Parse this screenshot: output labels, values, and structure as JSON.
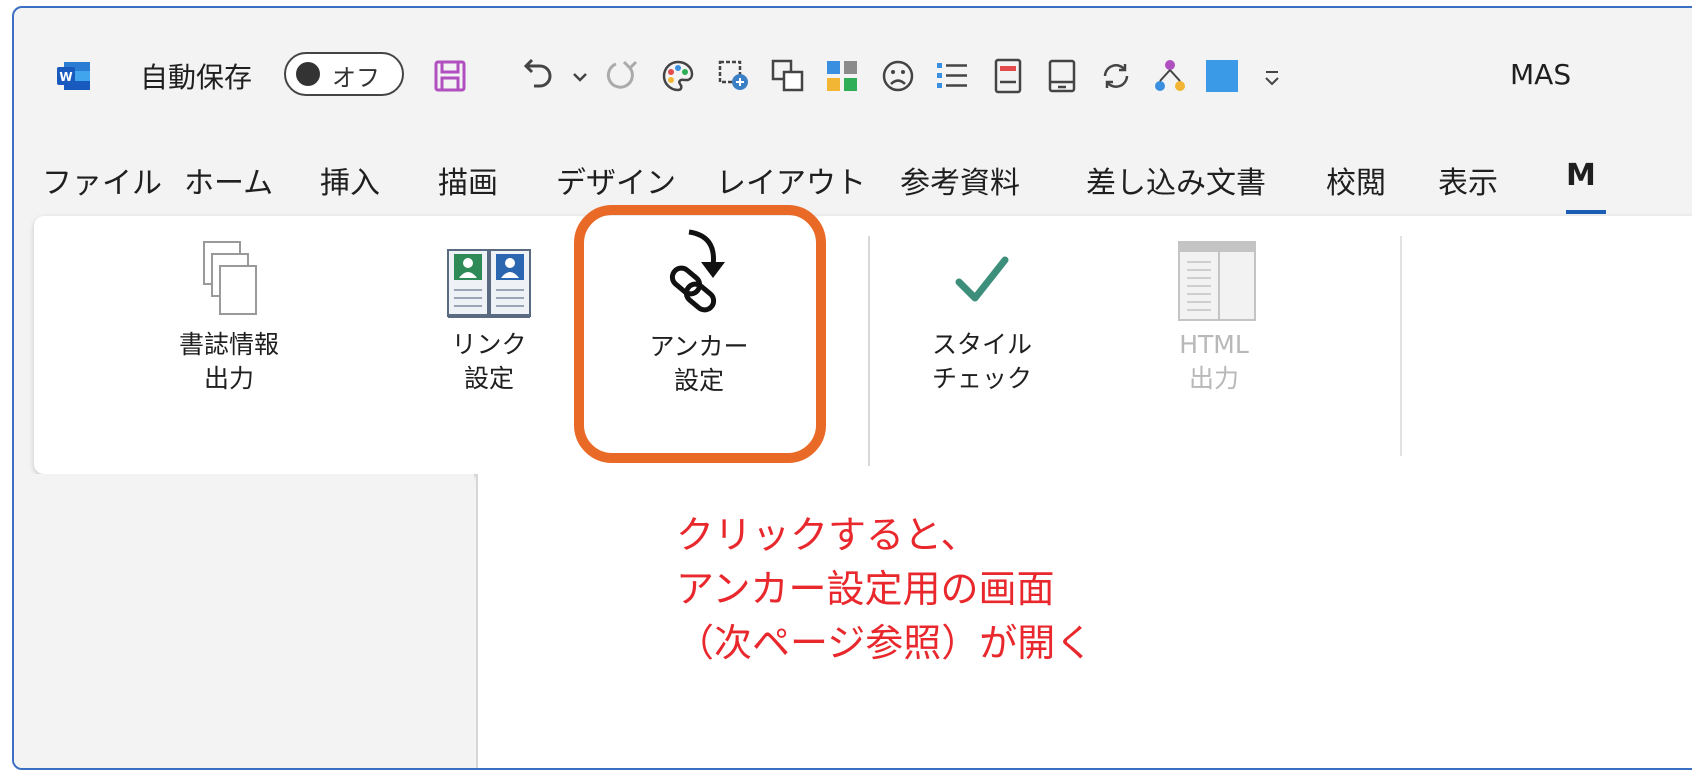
{
  "quick_access": {
    "autosave_label": "自動保存",
    "autosave_state": "オフ",
    "doc_title": "MAS",
    "icons": [
      "word-app-icon",
      "save-icon",
      "undo-icon",
      "undo-dropdown-icon",
      "redo-icon",
      "palette-icon",
      "screen-capture-icon",
      "copy-window-icon",
      "grid-icon",
      "sad-face-icon",
      "bullet-list-icon",
      "form-icon",
      "phone-icon",
      "refresh-icon",
      "org-chart-icon",
      "blue-square-icon",
      "customize-dropdown-icon"
    ]
  },
  "tabs": [
    "ファイル",
    "ホーム",
    "挿入",
    "描画",
    "デザイン",
    "レイアウト",
    "参考資料",
    "差し込み文書",
    "校閲",
    "表示",
    "M"
  ],
  "ribbon": {
    "buttons": [
      {
        "line1": "書誌情報",
        "line2": "出力",
        "icon": "copies-icon",
        "enabled": true
      },
      {
        "line1": "リンク",
        "line2": "設定",
        "icon": "book-people-icon",
        "enabled": true
      },
      {
        "line1": "アンカー",
        "line2": "設定",
        "icon": "chain-link-arrow-icon",
        "enabled": true
      },
      {
        "line1": "スタイル",
        "line2": "チェック",
        "icon": "checkmark-icon",
        "enabled": true
      },
      {
        "line1": "HTML",
        "line2": "出力",
        "icon": "html-page-icon",
        "enabled": false
      }
    ]
  },
  "annotation": {
    "lines": [
      "クリックすると、",
      "アンカー設定用の画面",
      "（次ページ参照）が開く"
    ]
  },
  "colors": {
    "highlight": "#e86a26",
    "annotation_text": "#e8282c",
    "window_border": "#3b6fc4",
    "save_icon": "#b04fc0",
    "check_icon": "#3d8f7c"
  }
}
